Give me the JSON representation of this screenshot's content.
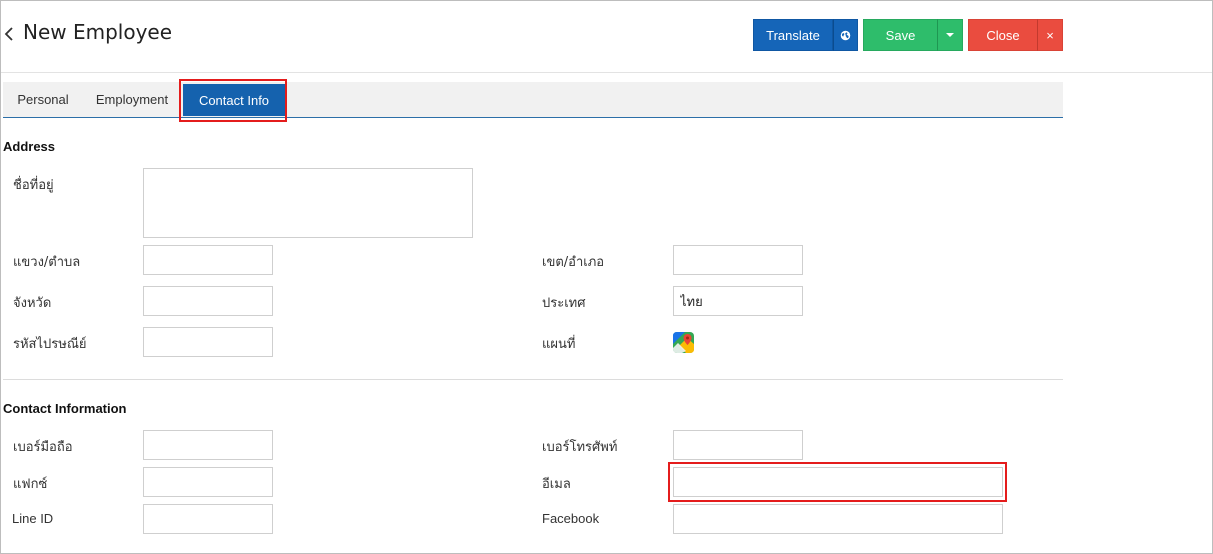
{
  "header": {
    "title": "New Employee",
    "translate_label": "Translate",
    "save_label": "Save",
    "close_label": "Close",
    "close_x": "×"
  },
  "tabs": [
    {
      "label": "Personal",
      "active": false
    },
    {
      "label": "Employment",
      "active": false
    },
    {
      "label": "Contact Info",
      "active": true
    }
  ],
  "address": {
    "section_title": "Address",
    "address_label": "ชื่อที่อยู่",
    "address_value": "",
    "subdistrict_label": "แขวง/ตำบล",
    "subdistrict_value": "",
    "district_label": "เขต/อำเภอ",
    "district_value": "",
    "province_label": "จังหวัด",
    "province_value": "",
    "country_label": "ประเทศ",
    "country_value": "ไทย",
    "postcode_label": "รหัสไปรษณีย์",
    "postcode_value": "",
    "map_label": "แผนที่",
    "map_icon": "google-maps-icon"
  },
  "contact": {
    "section_title": "Contact Information",
    "mobile_label": "เบอร์มือถือ",
    "mobile_value": "",
    "phone_label": "เบอร์โทรศัพท์",
    "phone_value": "",
    "fax_label": "แฟกซ์",
    "fax_value": "",
    "email_label": "อีเมล",
    "email_value": "",
    "line_label": "Line ID",
    "line_value": "",
    "facebook_label": "Facebook",
    "facebook_value": ""
  },
  "colors": {
    "translate": "#1565b8",
    "save": "#2ebd6b",
    "close": "#ea4c3f",
    "active_tab": "#1562ae",
    "highlight": "#e41c1c"
  }
}
